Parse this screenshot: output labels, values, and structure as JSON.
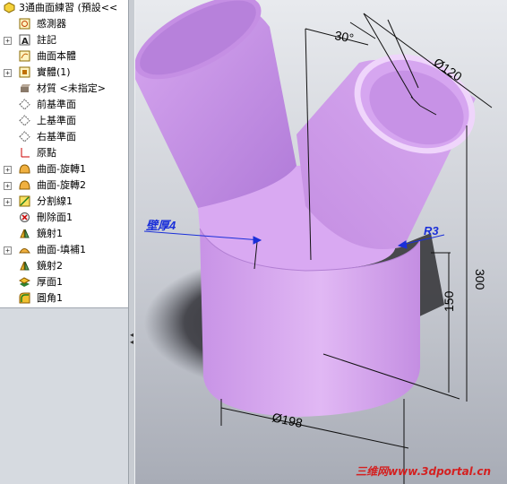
{
  "tree": {
    "root": {
      "label": "3通曲面練習 (預設<<",
      "icon": "part-icon"
    },
    "items": [
      {
        "label": "感測器",
        "icon": "sensor-icon",
        "expandable": false
      },
      {
        "label": "註記",
        "icon": "annotation-icon",
        "expandable": true
      },
      {
        "label": "曲面本體",
        "icon": "surface-bodies-icon",
        "expandable": false
      },
      {
        "label": "實體(1)",
        "icon": "solid-bodies-icon",
        "expandable": true
      },
      {
        "label": "材質 <未指定>",
        "icon": "material-icon",
        "expandable": false
      },
      {
        "label": "前基準面",
        "icon": "plane-icon",
        "expandable": false
      },
      {
        "label": "上基準面",
        "icon": "plane-icon",
        "expandable": false
      },
      {
        "label": "右基準面",
        "icon": "plane-icon",
        "expandable": false
      },
      {
        "label": "原點",
        "icon": "origin-icon",
        "expandable": false
      },
      {
        "label": "曲面-旋轉1",
        "icon": "surface-revolve-icon",
        "expandable": true
      },
      {
        "label": "曲面-旋轉2",
        "icon": "surface-revolve-icon",
        "expandable": true
      },
      {
        "label": "分割線1",
        "icon": "split-line-icon",
        "expandable": true
      },
      {
        "label": "刪除面1",
        "icon": "delete-face-icon",
        "expandable": false
      },
      {
        "label": "鏡射1",
        "icon": "mirror-icon",
        "expandable": false
      },
      {
        "label": "曲面-填補1",
        "icon": "surface-fill-icon",
        "expandable": true
      },
      {
        "label": "鏡射2",
        "icon": "mirror-icon",
        "expandable": false
      },
      {
        "label": "厚面1",
        "icon": "thicken-icon",
        "expandable": false
      },
      {
        "label": "圓角1",
        "icon": "fillet-icon",
        "expandable": false
      }
    ]
  },
  "viewport": {
    "model_color": "#cf9ae8",
    "dimensions": {
      "angle": "30°",
      "top_diameter": "Ø120",
      "height_total": "300",
      "height_lower": "150",
      "bottom_diameter": "Ø198",
      "fillet_radius": "R3",
      "thickness_label": "壁厚4"
    },
    "watermark": "三维网www.3dportal.cn"
  }
}
